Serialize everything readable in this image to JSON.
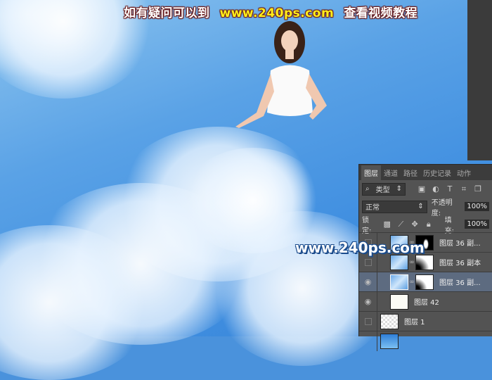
{
  "banner": {
    "left": "如有疑问可以到",
    "url": "www.240ps.com",
    "right": "查看视频教程"
  },
  "watermark": "www.240ps.com",
  "layers_panel": {
    "tabs": [
      "图层",
      "通道",
      "路径",
      "历史记录",
      "动作"
    ],
    "filter": {
      "label": "类型",
      "icon": "search-icon"
    },
    "blend_mode": "正常",
    "opacity_label": "不透明度:",
    "opacity_value": "100%",
    "lock_label": "锁定:",
    "fill_label": "填充:",
    "fill_value": "100%",
    "layers": [
      {
        "name": "图层 36 副...",
        "visible": false,
        "selected": false
      },
      {
        "name": "图层 36 副本",
        "visible": false,
        "selected": false
      },
      {
        "name": "图层 36 副...",
        "visible": true,
        "selected": true
      },
      {
        "name": "图层 42",
        "visible": true,
        "selected": false
      },
      {
        "name": "图层 1",
        "visible": false,
        "selected": false
      }
    ]
  }
}
